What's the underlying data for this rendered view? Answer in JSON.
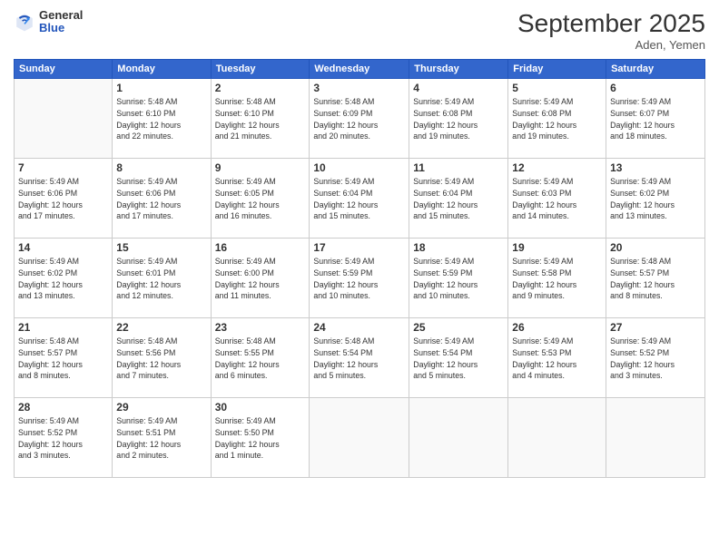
{
  "header": {
    "logo_general": "General",
    "logo_blue": "Blue",
    "month_title": "September 2025",
    "subtitle": "Aden, Yemen"
  },
  "weekdays": [
    "Sunday",
    "Monday",
    "Tuesday",
    "Wednesday",
    "Thursday",
    "Friday",
    "Saturday"
  ],
  "weeks": [
    [
      {
        "day": "",
        "info": ""
      },
      {
        "day": "1",
        "info": "Sunrise: 5:48 AM\nSunset: 6:10 PM\nDaylight: 12 hours\nand 22 minutes."
      },
      {
        "day": "2",
        "info": "Sunrise: 5:48 AM\nSunset: 6:10 PM\nDaylight: 12 hours\nand 21 minutes."
      },
      {
        "day": "3",
        "info": "Sunrise: 5:48 AM\nSunset: 6:09 PM\nDaylight: 12 hours\nand 20 minutes."
      },
      {
        "day": "4",
        "info": "Sunrise: 5:49 AM\nSunset: 6:08 PM\nDaylight: 12 hours\nand 19 minutes."
      },
      {
        "day": "5",
        "info": "Sunrise: 5:49 AM\nSunset: 6:08 PM\nDaylight: 12 hours\nand 19 minutes."
      },
      {
        "day": "6",
        "info": "Sunrise: 5:49 AM\nSunset: 6:07 PM\nDaylight: 12 hours\nand 18 minutes."
      }
    ],
    [
      {
        "day": "7",
        "info": "Sunrise: 5:49 AM\nSunset: 6:06 PM\nDaylight: 12 hours\nand 17 minutes."
      },
      {
        "day": "8",
        "info": "Sunrise: 5:49 AM\nSunset: 6:06 PM\nDaylight: 12 hours\nand 17 minutes."
      },
      {
        "day": "9",
        "info": "Sunrise: 5:49 AM\nSunset: 6:05 PM\nDaylight: 12 hours\nand 16 minutes."
      },
      {
        "day": "10",
        "info": "Sunrise: 5:49 AM\nSunset: 6:04 PM\nDaylight: 12 hours\nand 15 minutes."
      },
      {
        "day": "11",
        "info": "Sunrise: 5:49 AM\nSunset: 6:04 PM\nDaylight: 12 hours\nand 15 minutes."
      },
      {
        "day": "12",
        "info": "Sunrise: 5:49 AM\nSunset: 6:03 PM\nDaylight: 12 hours\nand 14 minutes."
      },
      {
        "day": "13",
        "info": "Sunrise: 5:49 AM\nSunset: 6:02 PM\nDaylight: 12 hours\nand 13 minutes."
      }
    ],
    [
      {
        "day": "14",
        "info": "Sunrise: 5:49 AM\nSunset: 6:02 PM\nDaylight: 12 hours\nand 13 minutes."
      },
      {
        "day": "15",
        "info": "Sunrise: 5:49 AM\nSunset: 6:01 PM\nDaylight: 12 hours\nand 12 minutes."
      },
      {
        "day": "16",
        "info": "Sunrise: 5:49 AM\nSunset: 6:00 PM\nDaylight: 12 hours\nand 11 minutes."
      },
      {
        "day": "17",
        "info": "Sunrise: 5:49 AM\nSunset: 5:59 PM\nDaylight: 12 hours\nand 10 minutes."
      },
      {
        "day": "18",
        "info": "Sunrise: 5:49 AM\nSunset: 5:59 PM\nDaylight: 12 hours\nand 10 minutes."
      },
      {
        "day": "19",
        "info": "Sunrise: 5:49 AM\nSunset: 5:58 PM\nDaylight: 12 hours\nand 9 minutes."
      },
      {
        "day": "20",
        "info": "Sunrise: 5:48 AM\nSunset: 5:57 PM\nDaylight: 12 hours\nand 8 minutes."
      }
    ],
    [
      {
        "day": "21",
        "info": "Sunrise: 5:48 AM\nSunset: 5:57 PM\nDaylight: 12 hours\nand 8 minutes."
      },
      {
        "day": "22",
        "info": "Sunrise: 5:48 AM\nSunset: 5:56 PM\nDaylight: 12 hours\nand 7 minutes."
      },
      {
        "day": "23",
        "info": "Sunrise: 5:48 AM\nSunset: 5:55 PM\nDaylight: 12 hours\nand 6 minutes."
      },
      {
        "day": "24",
        "info": "Sunrise: 5:48 AM\nSunset: 5:54 PM\nDaylight: 12 hours\nand 5 minutes."
      },
      {
        "day": "25",
        "info": "Sunrise: 5:49 AM\nSunset: 5:54 PM\nDaylight: 12 hours\nand 5 minutes."
      },
      {
        "day": "26",
        "info": "Sunrise: 5:49 AM\nSunset: 5:53 PM\nDaylight: 12 hours\nand 4 minutes."
      },
      {
        "day": "27",
        "info": "Sunrise: 5:49 AM\nSunset: 5:52 PM\nDaylight: 12 hours\nand 3 minutes."
      }
    ],
    [
      {
        "day": "28",
        "info": "Sunrise: 5:49 AM\nSunset: 5:52 PM\nDaylight: 12 hours\nand 3 minutes."
      },
      {
        "day": "29",
        "info": "Sunrise: 5:49 AM\nSunset: 5:51 PM\nDaylight: 12 hours\nand 2 minutes."
      },
      {
        "day": "30",
        "info": "Sunrise: 5:49 AM\nSunset: 5:50 PM\nDaylight: 12 hours\nand 1 minute."
      },
      {
        "day": "",
        "info": ""
      },
      {
        "day": "",
        "info": ""
      },
      {
        "day": "",
        "info": ""
      },
      {
        "day": "",
        "info": ""
      }
    ]
  ]
}
